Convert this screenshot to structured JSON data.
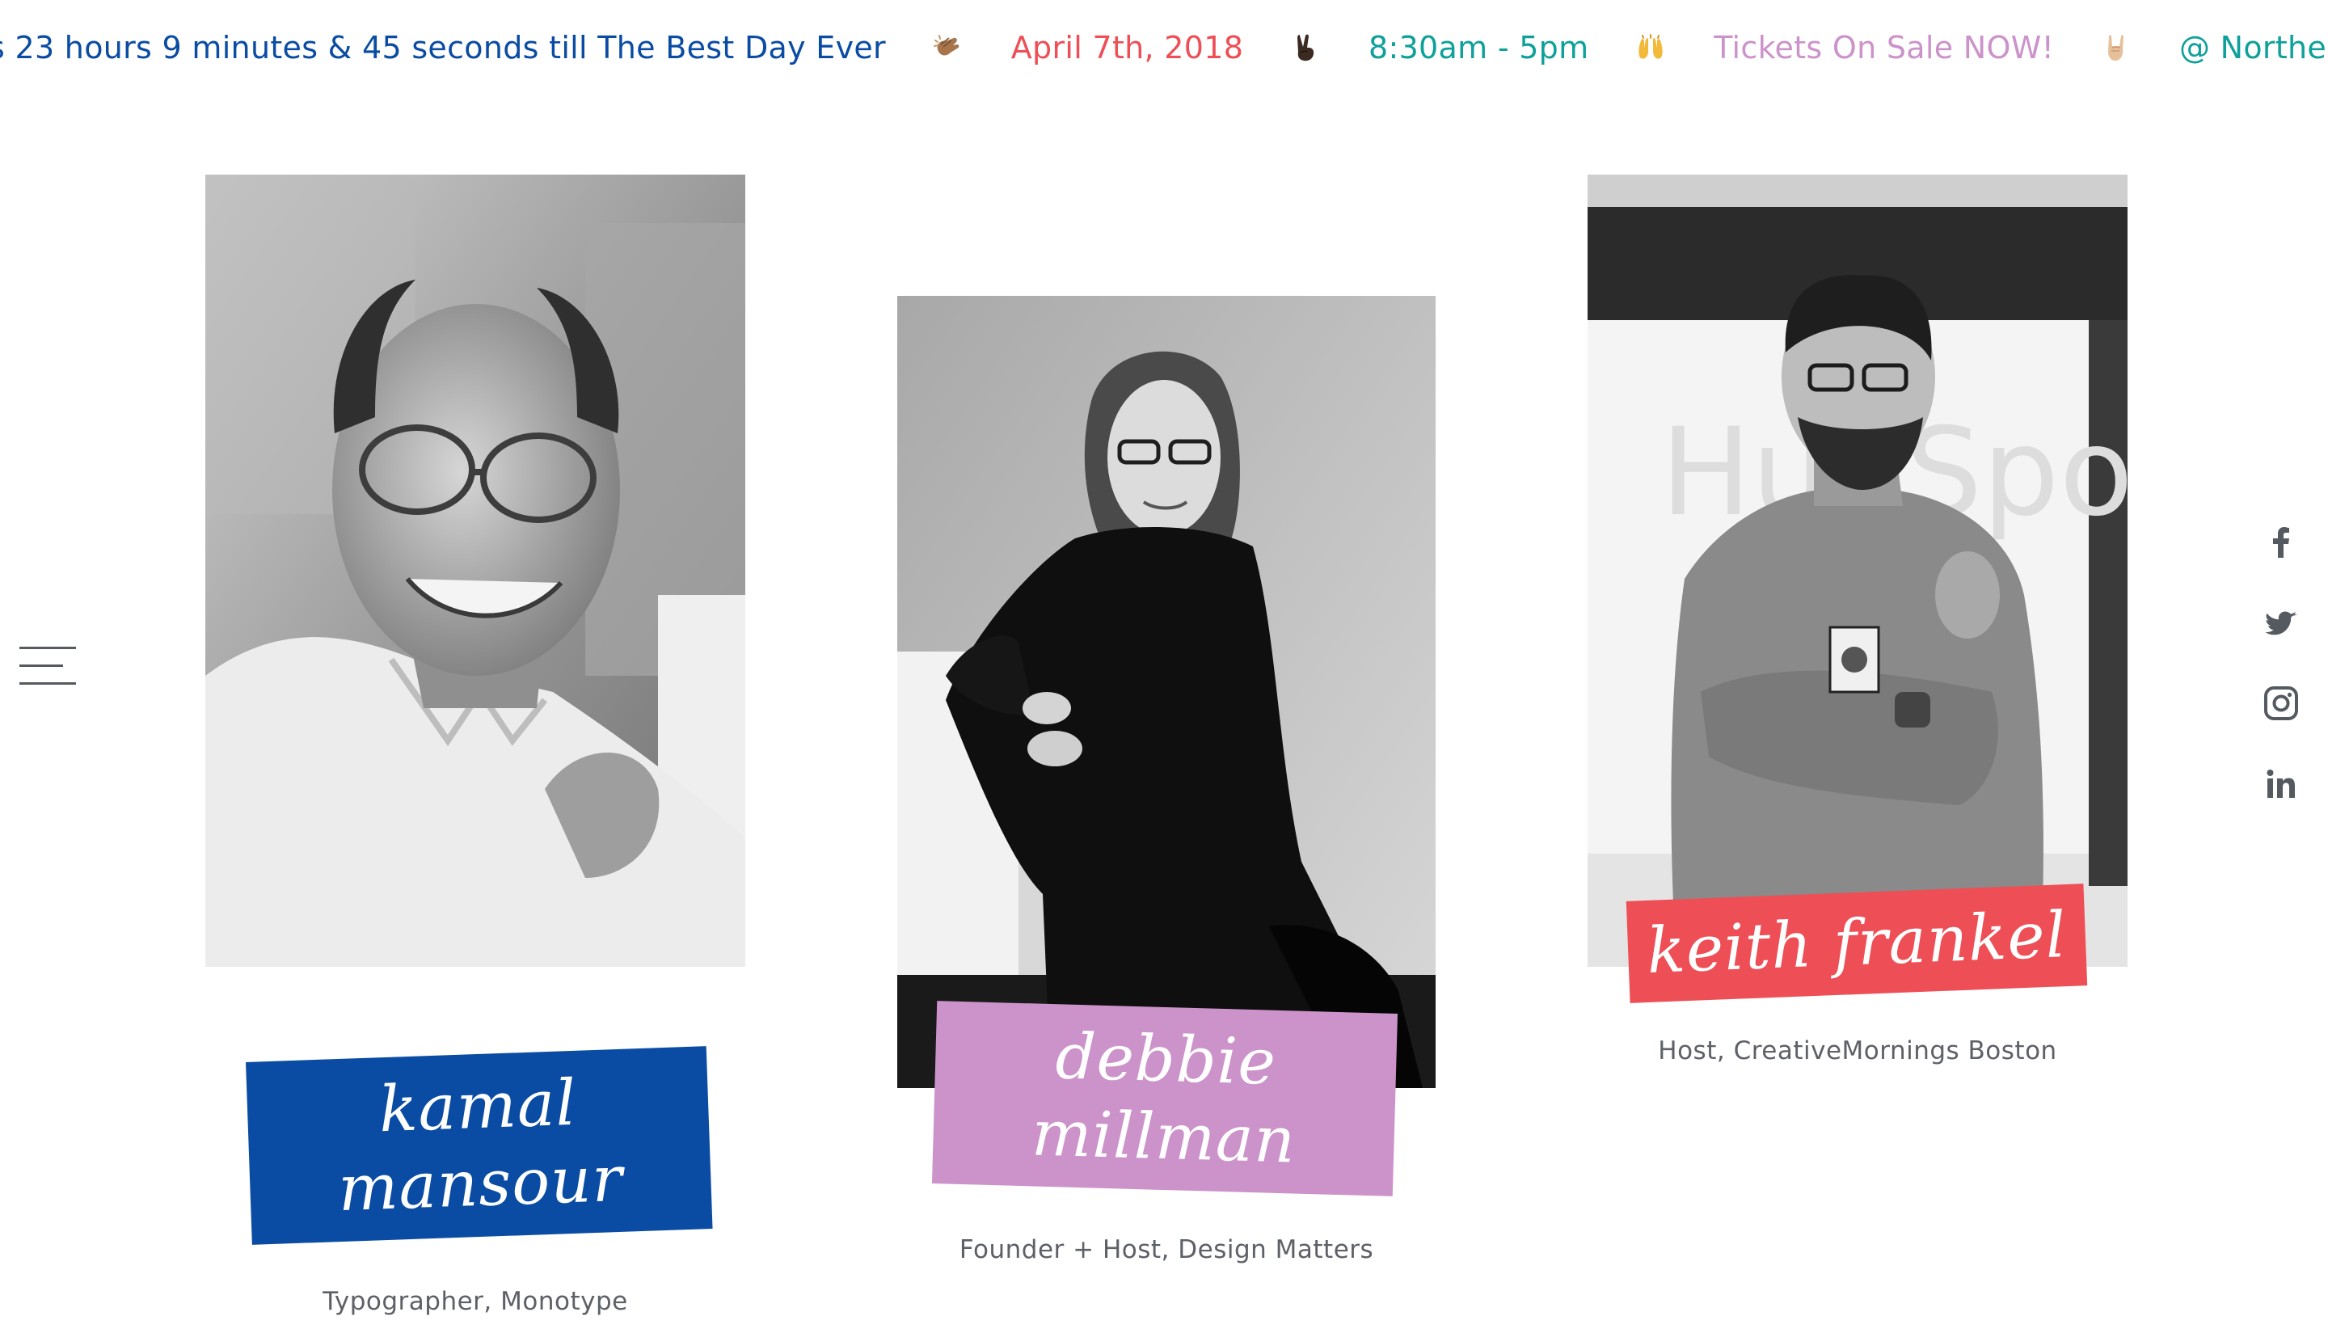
{
  "ticker": {
    "countdown": "s 23 hours 9 minutes & 45 seconds till The Best Day Ever",
    "date": "April 7th, 2018",
    "time": "8:30am - 5pm",
    "tickets": "Tickets On Sale NOW!",
    "venue": "@ Northeastern University,",
    "emojis": [
      "clapping-hands",
      "victory-hand",
      "raised-hands",
      "rock-on-hand"
    ]
  },
  "menu": {
    "icon": "hamburger-menu-icon"
  },
  "social": [
    {
      "name": "facebook",
      "icon": "facebook-icon"
    },
    {
      "name": "twitter",
      "icon": "twitter-icon"
    },
    {
      "name": "instagram",
      "icon": "instagram-icon"
    },
    {
      "name": "linkedin",
      "icon": "linkedin-icon"
    }
  ],
  "speakers": [
    {
      "name_line1": "kamal",
      "name_line2": "mansour",
      "role": "Typographer, Monotype",
      "label_color": "#0a4ca3"
    },
    {
      "name_line1": "debbie",
      "name_line2": "millman",
      "role": "Founder + Host, Design Matters",
      "label_color": "#cc93cb"
    },
    {
      "name_line1": "keith frankel",
      "name_line2": "",
      "role": "Host, CreativeMornings Boston",
      "label_color": "#ee4e56"
    }
  ],
  "colors": {
    "blue": "#0a4ca3",
    "coral": "#ee4e56",
    "teal": "#0ea09a",
    "lilac": "#cc93cb",
    "icon_gray": "#555a60",
    "role_text": "#5d6066"
  }
}
